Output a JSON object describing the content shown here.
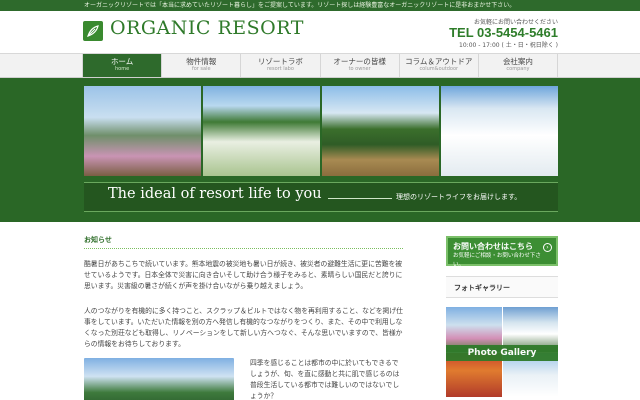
{
  "topbar": {
    "text": "オーガニックリゾートでは「本当に求めていたリゾート暮らし」をご提案しています。リゾート探しは経験豊富なオーガニックリゾートに是非おまかせ下さい。"
  },
  "header": {
    "logo_text": "ORGANIC RESORT",
    "contact_caption": "お気軽にお問い合わせください",
    "tel": "TEL 03-5454-5461",
    "hours": "10:00 - 17:00 ( 土・日・祝日除く )"
  },
  "nav": [
    {
      "jp": "ホーム",
      "en": "home"
    },
    {
      "jp": "物件情報",
      "en": "for sale"
    },
    {
      "jp": "リゾートラボ",
      "en": "resort labo"
    },
    {
      "jp": "オーナーの皆様",
      "en": "to owner"
    },
    {
      "jp": "コラム＆アウトドア",
      "en": "colum&outdoor"
    },
    {
      "jp": "会社案内",
      "en": "company"
    }
  ],
  "hero": {
    "tagline": "The ideal of resort life to you",
    "tagline_jp": "理想のリゾートライフをお届けします。"
  },
  "news": {
    "title": "お知らせ",
    "para1": "酷暑日があちこちで続いています。熊本地震の被災地も暑い日が続き、被災者の避難生活に更に苦難を被せているようです。日本全体で災害に向き合いそして助け合う様子をみると、素晴らしい国民だと誇りに思います。災害級の暑さが続くが声を掛け合いながら乗り越えましょう。",
    "para2": "人のつながりを有機的に多く持つこと、スクラップ＆ビルトではなく物を再利用すること、などを掲げ仕事をしています。いただいた情報を別の方へ発信し有機的なつながりをつくり、また、その中で利用しなくなった別荘なども取得し、リノベーションをして新しい方へつなぐ、そんな思いでいますので、皆様からの情報をお待ちしております。",
    "para3": "四季を感じることは都市の中に於いてもできるでしょうが、旬、を直に感動と共に肌で感じるのは普段生活している都市では難しいのではないでしょうか？"
  },
  "sidebar": {
    "contact_title": "お問い合わせはこちら",
    "contact_sub": "お気軽にご相談・お問い合わせ下さい。",
    "gallery_heading": "フォトギャラリー",
    "gallery_label": "Photo Gallery"
  }
}
